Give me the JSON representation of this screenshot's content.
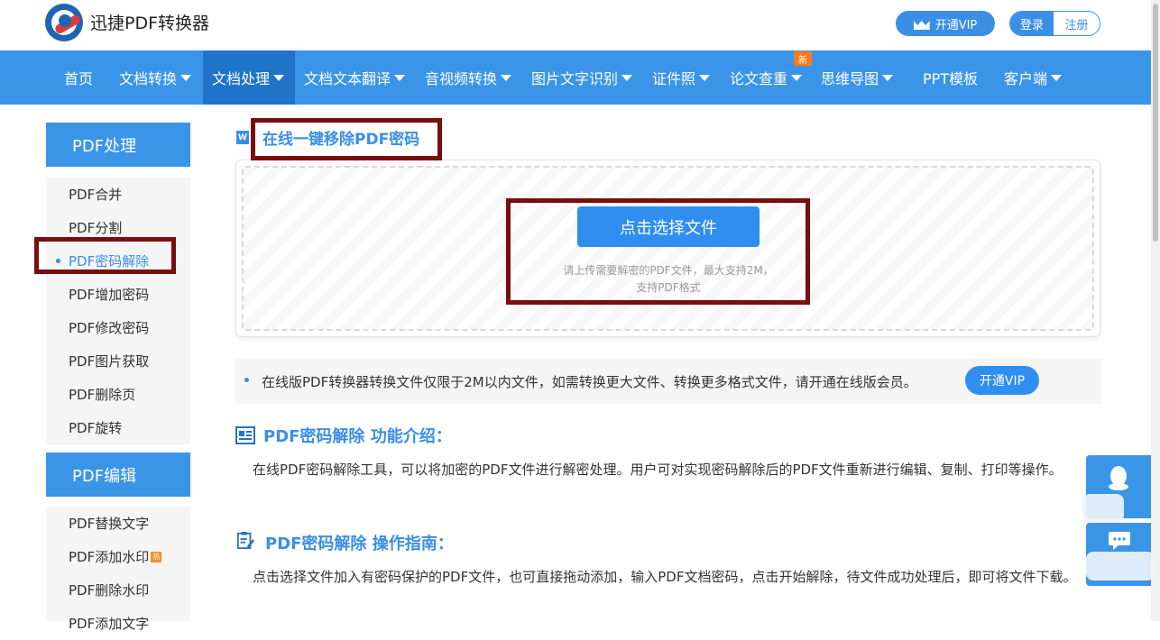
{
  "header": {
    "app_title": "迅捷PDF转换器",
    "vip_label": "开通VIP",
    "login_label": "登录",
    "register_label": "注册"
  },
  "nav": {
    "items": [
      {
        "label": "首页"
      },
      {
        "label": "文档转换"
      },
      {
        "label": "文档处理"
      },
      {
        "label": "文档文本翻译"
      },
      {
        "label": "音视频转换"
      },
      {
        "label": "图片文字识别"
      },
      {
        "label": "证件照"
      },
      {
        "label": "论文查重"
      },
      {
        "label": "思维导图"
      },
      {
        "label": "PPT模板"
      },
      {
        "label": "客户端"
      }
    ],
    "new_badge": "新",
    "active_index": 2
  },
  "sidebar": {
    "group1_title": "PDF处理",
    "group1_items": [
      "PDF合并",
      "PDF分割",
      "PDF密码解除",
      "PDF增加密码",
      "PDF修改密码",
      "PDF图片获取",
      "PDF删除页",
      "PDF旋转"
    ],
    "group2_title": "PDF编辑",
    "group2_items": [
      "PDF替换文字",
      "PDF添加水印",
      "PDF删除水印",
      "PDF添加文字"
    ],
    "hot_badge": "热"
  },
  "main": {
    "tool_title_icon": "W",
    "tool_title": "在线一键移除PDF密码",
    "choose_button": "点击选择文件",
    "upload_hint_line1": "请上传需要解密的PDF文件，最大支持2M，",
    "upload_hint_line2": "支持PDF格式",
    "notice_text": "在线版PDF转换器转换文件仅限于2M以内文件，如需转换更大文件、转换更多格式文件，请开通在线版会员。",
    "notice_vip": "开通VIP",
    "intro_title": "PDF密码解除 功能介绍：",
    "intro_text": "在线PDF密码解除工具，可以将加密的PDF文件进行解密处理。用户可对实现密码解除后的PDF文件重新进行编辑、复制、打印等操作。",
    "guide_title": "PDF密码解除 操作指南：",
    "guide_text": "点击选择文件加入有密码保护的PDF文件，也可直接拖动添加，输入PDF文档密码，点击开始解除，待文件成功处理后，即可将文件下载。"
  },
  "float": {
    "qq_icon": "qq-icon",
    "chat_icon": "chat-icon"
  },
  "colors": {
    "primary": "#3a95e8",
    "nav_active": "#1f73c9",
    "highlight_box": "#7a0d0d",
    "badge": "#ff7a1a"
  }
}
